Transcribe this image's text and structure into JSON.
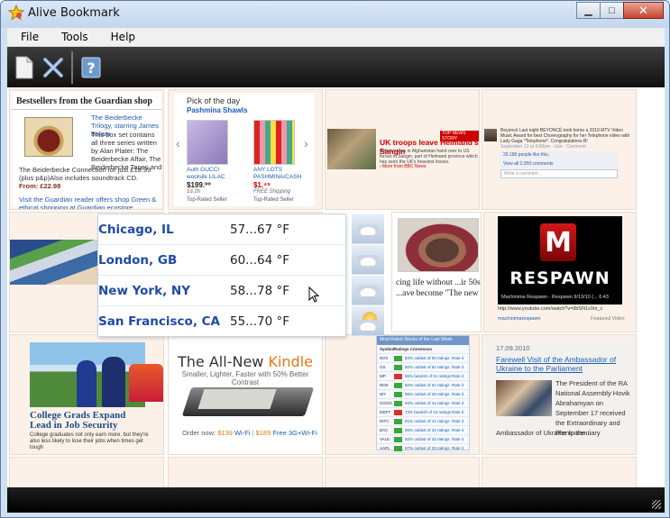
{
  "window": {
    "title": "Alive Bookmark",
    "minimize_glyph": "▁",
    "maximize_glyph": "□",
    "close_glyph": "✕"
  },
  "menu": [
    "File",
    "Tools",
    "Help"
  ],
  "toolbar": {
    "buttons": [
      {
        "icon": "new-page-icon"
      },
      {
        "icon": "delete-icon"
      },
      {
        "icon": "help-icon"
      }
    ]
  },
  "tiles": {
    "guardian": {
      "title": "Bestsellers from the Guardian shop",
      "book_link": "The Beiderbecke Trilogy, starring James Bolam",
      "desc": "This box set contains all three series written by Alan Plater: The Beiderbecke Affair, The Beiderbecke Tapes and",
      "desc2": "The Beiderbecke Connection for just £19.99 (plus p&p)Also includes soundtrack CD.",
      "price": "From: £22.98",
      "footer": "Visit the Guardian reader offers shop Green & ethical shopping at Guardian ecostore"
    },
    "ebay": {
      "title": "Pick of the day",
      "subtitle": "Pashmina Shawls",
      "item1": "Auth GUCCI woolsilk LILAC",
      "price1": "$199.⁰⁰",
      "note1": "1d 2h",
      "item2": "ANY LOTS PASHMINA/CASH",
      "price2": "$1.⁴⁹",
      "note2": "FREE Shipping",
      "seller": "Top-Rated Seller",
      "prev": "‹",
      "next": "›"
    },
    "helmand": {
      "tag": "TOP NEWS STORY",
      "headline": "UK troops leave Helmand's Sangin",
      "body": "British troops in Afghanistan hand over to US forces in Sangin, part of Helmand province which has seen the UK's heaviest losses.",
      "more": "› More from BBC News"
    },
    "facebook": {
      "text": "Beyoncé Last night BEYONCÉ took home a 2010 MTV Video Music Award for best Choreography for her Telephone video with Lady Gaga *Telephone*. Congratulations B!",
      "meta": "September 13 at 4:58pm · Like · Comment",
      "likes": "29,180 people like this.",
      "comments": "View all 2,059 comments",
      "comment_placeholder": "Write a comment..."
    },
    "woman": {
      "text": "cing life without ...ir 50s ...ave become \"The new"
    },
    "respawn": {
      "logo": "M",
      "word": "RESPAWN",
      "caption": "Machinima Respawn - Respawn 9/13/10 (...   6:43",
      "url": "http://www.youtube.com/watch?v=9bSN1c0m_c",
      "views": "machinimarespawn",
      "featured": "Featured Video"
    },
    "college": {
      "headline": "College Grads Expand Lead in Job Security",
      "body": "College graduates not only earn more, but they're also less likely to lose their jobs when times get tough"
    },
    "kindle": {
      "title_prefix": "The All-New ",
      "title_brand": "Kindle",
      "subtitle": "Smaller, Lighter, Faster with 50% Better Contrast",
      "order_label": "Order now: ",
      "price_wifi": "$139",
      "wifi": " Wi-Fi",
      "sep": " | ",
      "price_3g": "$189",
      "free_3g": " Free 3G+Wi-Fi"
    },
    "stocks": {
      "title": "Most Rated Stocks of the Last Week",
      "col1": "Symbol",
      "col2": "Ratings Consensus",
      "rows": [
        {
          "sym": "NVS",
          "bar": "#3ca53c",
          "txt": "83% outlast of 83 ratings",
          "rate": "Rate it"
        },
        {
          "sym": "GS",
          "bar": "#3ca53c",
          "txt": "90% outlast of 62 ratings",
          "rate": "Rate it"
        },
        {
          "sym": "MP",
          "bar": "#d9322a",
          "txt": "86% bearish of 51 ratings",
          "rate": "Rate it"
        },
        {
          "sym": "NOK",
          "bar": "#3ca53c",
          "txt": "92% outlast of 51 ratings",
          "rate": "Rate it"
        },
        {
          "sym": "WY",
          "bar": "#3ca53c",
          "txt": "96% outlast of 28 ratings",
          "rate": "Rate it"
        },
        {
          "sym": "GOOG",
          "bar": "#3ca53c",
          "txt": "93% outlast of 44 ratings",
          "rate": "Rate it"
        },
        {
          "sym": "MSFT",
          "bar": "#d9322a",
          "txt": "73% bearish of 44 ratings",
          "rate": "Rate it"
        },
        {
          "sym": "INTC",
          "bar": "#3ca53c",
          "txt": "81% outlast of 41 ratings",
          "rate": "Rate it"
        },
        {
          "sym": "BAC",
          "bar": "#3ca53c",
          "txt": "96% outlast of 34 ratings",
          "rate": "Rate it"
        },
        {
          "sym": "VALE",
          "bar": "#3ca53c",
          "txt": "92% outlast of 33 ratings",
          "rate": "Rate it"
        },
        {
          "sym": "AAPL",
          "bar": "#3ca53c",
          "txt": "87% outlast of 33 ratings",
          "rate": "Rate it"
        }
      ]
    },
    "ukraine": {
      "date": "17.09.2010",
      "headline": "Farewell Visit of the Ambassador of Ukraine to the Parliament",
      "body": "The President of the RA National Assembly Hovik Abrahamyan on September 17 received the Extraordinary and Plenipotentiary",
      "body2": "Ambassador of Ukraine to the..."
    }
  },
  "weather": [
    {
      "city": "Chicago, IL",
      "temp": "57...67 °F",
      "icon": "cloud-icon"
    },
    {
      "city": "London, GB",
      "temp": "60...64 °F",
      "icon": "cloud-icon"
    },
    {
      "city": "New York, NY",
      "temp": "58...78 °F",
      "icon": "cloud-icon"
    },
    {
      "city": "San Francisco, CA",
      "temp": "55...70 °F",
      "icon": "sun-icon"
    }
  ],
  "colors": {
    "toolbar": "#1a1a1a",
    "tile_bg": "#fbf1e8",
    "weather_city": "#1f4aa6"
  }
}
